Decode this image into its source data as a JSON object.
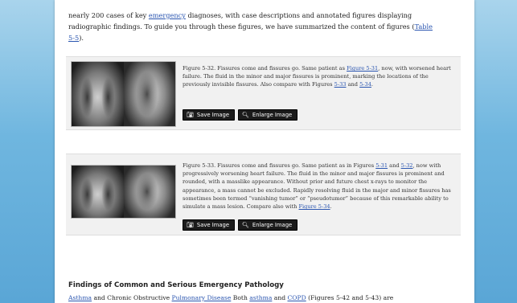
{
  "intro": {
    "line1_before": "nearly 200 cases of key ",
    "line1_link": "emergency",
    "line1_after": " diagnoses, with case descriptions and annotated figures displaying",
    "line2_before": "radiographic findings. To guide you through these figures, we have summarized the content of figures (",
    "line2_link": "Table",
    "line3_link": "5-5",
    "line3_after": ")."
  },
  "figure1": {
    "t1": "Figure 5-32. Fissures come and fissures go. Same patient as ",
    "l1": "Figure 5-31",
    "t2": ", now, with worsened heart failure. The fluid in the minor and major fissures is prominent, marking the locations of the previously invisible fissures. Also compare with Figures ",
    "l2": "5-33",
    "t3": " and ",
    "l3": "5-34",
    "t4": "."
  },
  "figure2": {
    "t1": "Figure 5-33. Fissures come and fissures go. Same patient as in Figures ",
    "l1": "5-31",
    "t2": " and ",
    "l2": "5-32",
    "t3": ", now with progressively worsening heart failure. The fluid in the minor and major fissures is prominent and rounded, with a masslike appearance. Without prior and future chest x-rays to monitor the appearance, a mass cannot be excluded. Rapidly resolving fluid in the major and minor fissures has sometimes been termed “vanishing tumor” or “pseudotumor” because of this remarkable ability to simulate a mass lesion. Compare also with ",
    "l3": "Figure 5-34",
    "t4": "."
  },
  "buttons": {
    "save": "Save Image",
    "enlarge": "Enlarge Image"
  },
  "section": {
    "title": "Findings of Common and Serious Emergency Pathology",
    "l1": "Asthma",
    "t1": " and Chronic Obstructive ",
    "l2": "Pulmonary Disease",
    "t2": " Both ",
    "l3": "asthma",
    "t3": " and ",
    "l4": "COPD",
    "t4": " (Figures 5-42 and 5-43) are"
  }
}
